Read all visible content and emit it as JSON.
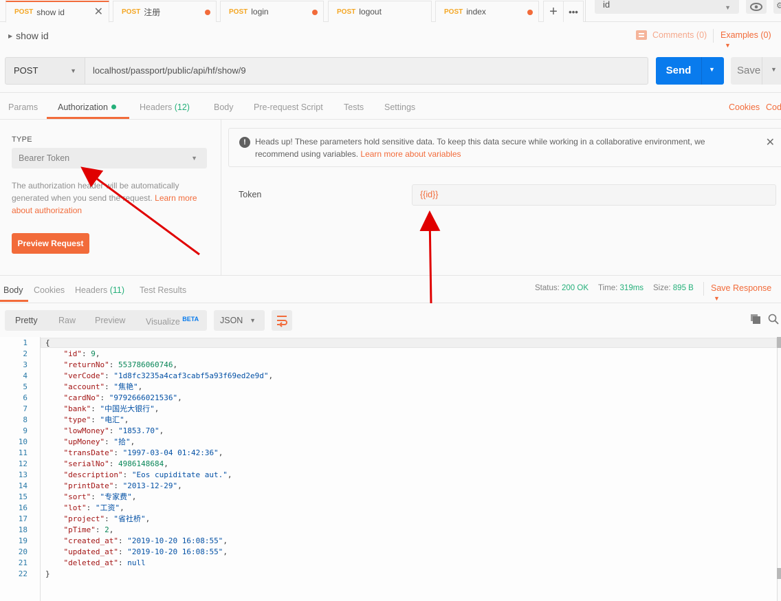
{
  "tabs": [
    {
      "method": "POST",
      "name": "show id",
      "active": true,
      "close_icon": "close-icon"
    },
    {
      "method": "POST",
      "name": "注册",
      "unsaved": true
    },
    {
      "method": "POST",
      "name": "login",
      "unsaved": true
    },
    {
      "method": "POST",
      "name": "logout"
    },
    {
      "method": "POST",
      "name": "index",
      "unsaved": true
    }
  ],
  "tab_actions": {
    "new_tab_icon": "plus-icon",
    "more_icon": "ellipsis-icon"
  },
  "environment": {
    "selected": "id",
    "eye_icon": "eye-icon",
    "settings_icon": "gear-icon"
  },
  "request": {
    "name": "show id",
    "comments_label": "Comments (0)",
    "examples_label": "Examples (0)",
    "method": "POST",
    "url": "localhost/passport/public/api/hf/show/9",
    "send_label": "Send",
    "save_label": "Save"
  },
  "request_tabs": {
    "params": "Params",
    "authorization": "Authorization",
    "headers": "Headers",
    "headers_count": "(12)",
    "body": "Body",
    "pre_request": "Pre-request Script",
    "tests": "Tests",
    "settings": "Settings",
    "cookies": "Cookies",
    "code": "Code"
  },
  "auth": {
    "type_label": "TYPE",
    "type_value": "Bearer Token",
    "description": "The authorization header will be automatically generated when you send the request. ",
    "learn_link": "Learn more about authorization",
    "preview_button": "Preview Request",
    "alert_text": "Heads up! These parameters hold sensitive data. To keep this data secure while working in a collaborative environment, we recommend using variables. ",
    "alert_link": "Learn more about variables",
    "token_label": "Token",
    "token_value": "{{id}}"
  },
  "response_tabs": {
    "body": "Body",
    "cookies": "Cookies",
    "headers": "Headers",
    "headers_count": "(11)",
    "test_results": "Test Results"
  },
  "response_status": {
    "status_label": "Status:",
    "status_value": "200 OK",
    "time_label": "Time:",
    "time_value": "319ms",
    "size_label": "Size:",
    "size_value": "895 B",
    "save_response": "Save Response"
  },
  "view_modes": {
    "pretty": "Pretty",
    "raw": "Raw",
    "preview": "Preview",
    "visualize": "Visualize",
    "beta": "BETA",
    "format": "JSON"
  },
  "response_body": [
    {
      "key": null,
      "open": "{"
    },
    {
      "key": "id",
      "value": "9",
      "vtype": "n",
      "comma": true
    },
    {
      "key": "returnNo",
      "value": "553786060746",
      "vtype": "n",
      "comma": true
    },
    {
      "key": "verCode",
      "value": "\"1d8fc3235a4caf3cabf5a93f69ed2e9d\"",
      "vtype": "s",
      "comma": true
    },
    {
      "key": "account",
      "value": "\"焦艳\"",
      "vtype": "s",
      "comma": true
    },
    {
      "key": "cardNo",
      "value": "\"9792666021536\"",
      "vtype": "s",
      "comma": true
    },
    {
      "key": "bank",
      "value": "\"中国光大银行\"",
      "vtype": "s",
      "comma": true
    },
    {
      "key": "type",
      "value": "\"电汇\"",
      "vtype": "s",
      "comma": true
    },
    {
      "key": "lowMoney",
      "value": "\"1853.70\"",
      "vtype": "s",
      "comma": true
    },
    {
      "key": "upMoney",
      "value": "\"拾\"",
      "vtype": "s",
      "comma": true
    },
    {
      "key": "transDate",
      "value": "\"1997-03-04 01:42:36\"",
      "vtype": "s",
      "comma": true
    },
    {
      "key": "serialNo",
      "value": "4986148684",
      "vtype": "n",
      "comma": true
    },
    {
      "key": "description",
      "value": "\"Eos cupiditate aut.\"",
      "vtype": "s",
      "comma": true
    },
    {
      "key": "printDate",
      "value": "\"2013-12-29\"",
      "vtype": "s",
      "comma": true
    },
    {
      "key": "sort",
      "value": "\"专家费\"",
      "vtype": "s",
      "comma": true
    },
    {
      "key": "lot",
      "value": "\"工资\"",
      "vtype": "s",
      "comma": true
    },
    {
      "key": "project",
      "value": "\"省社桥\"",
      "vtype": "s",
      "comma": true
    },
    {
      "key": "pTime",
      "value": "2",
      "vtype": "n",
      "comma": true
    },
    {
      "key": "created_at",
      "value": "\"2019-10-20 16:08:55\"",
      "vtype": "s",
      "comma": true
    },
    {
      "key": "updated_at",
      "value": "\"2019-10-20 16:08:55\"",
      "vtype": "s",
      "comma": true
    },
    {
      "key": "deleted_at",
      "value": "null",
      "vtype": "nl",
      "comma": false
    },
    {
      "key": null,
      "open": "}"
    }
  ],
  "colors": {
    "accent": "#f26b3a",
    "send_blue": "#097bed",
    "success_green": "#25b07a",
    "method_post": "#f4a623",
    "annotation_arrow": "#e00000"
  }
}
